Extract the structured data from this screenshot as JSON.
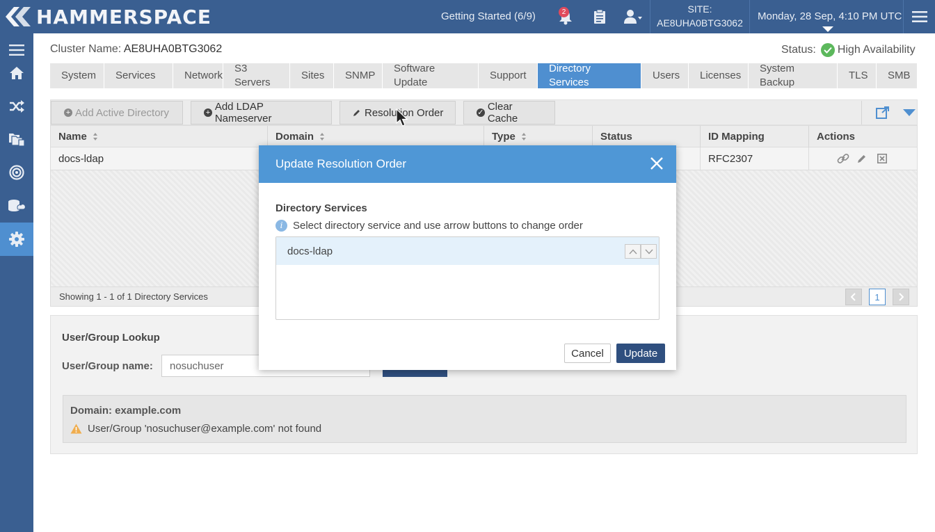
{
  "header": {
    "brand": "HAMMERSPACE",
    "getting_started": "Getting Started (6/9)",
    "notification_count": "2",
    "site_label": "SITE:",
    "site_name": "AE8UHA0BTG3062",
    "datetime": "Monday, 28 Sep, 4:10 PM UTC",
    "icons": [
      "bell-icon",
      "clipboard-icon",
      "user-icon",
      "hamburger-icon"
    ]
  },
  "sidebar": {
    "items": [
      {
        "name": "menu",
        "icon": "hamburger-icon"
      },
      {
        "name": "home",
        "icon": "home-icon"
      },
      {
        "name": "shuffle",
        "icon": "shuffle-icon"
      },
      {
        "name": "shares",
        "icon": "folders-icon"
      },
      {
        "name": "objectives",
        "icon": "target-icon"
      },
      {
        "name": "storage",
        "icon": "storage-icon"
      },
      {
        "name": "settings",
        "icon": "gear-icon",
        "active": true
      }
    ]
  },
  "main": {
    "cluster_label": "Cluster Name:",
    "cluster_name": "AE8UHA0BTG3062",
    "status_label": "Status:",
    "status_value": "High Availability",
    "tabs": [
      {
        "label": "System"
      },
      {
        "label": "Services"
      },
      {
        "label": "Network"
      },
      {
        "label": "S3 Servers"
      },
      {
        "label": "Sites"
      },
      {
        "label": "SNMP"
      },
      {
        "label": "Software Update"
      },
      {
        "label": "Support"
      },
      {
        "label": "Directory Services",
        "active": true
      },
      {
        "label": "Users"
      },
      {
        "label": "Licenses"
      },
      {
        "label": "System Backup"
      },
      {
        "label": "TLS"
      },
      {
        "label": "SMB"
      }
    ],
    "toolbar": {
      "add_ad": "Add Active Directory",
      "add_ldap": "Add LDAP Nameserver",
      "resolution_order": "Resolution Order",
      "clear_cache": "Clear Cache"
    },
    "table": {
      "columns": [
        "Name",
        "Domain",
        "Type",
        "Status",
        "ID Mapping",
        "Actions"
      ],
      "rows": [
        {
          "name": "docs-ldap",
          "domain": "",
          "type": "",
          "status": "",
          "id_mapping": "RFC2307"
        }
      ],
      "footer": "Showing 1 - 1 of 1 Directory Services",
      "page": "1"
    },
    "lookup": {
      "title": "User/Group Lookup",
      "label": "User/Group name:",
      "value": "nosuchuser",
      "result_domain": "Domain: example.com",
      "result_message": "User/Group 'nosuchuser@example.com' not found"
    }
  },
  "modal": {
    "title": "Update Resolution Order",
    "section_title": "Directory Services",
    "hint": "Select directory service and use arrow buttons to change order",
    "items": [
      "docs-ldap"
    ],
    "cancel": "Cancel",
    "update": "Update"
  },
  "colors": {
    "topbar": "#3a5f91",
    "accent": "#4f8fd0",
    "modal_header": "#4f97d6",
    "primary_button": "#2f4f7f",
    "success": "#5cb85c"
  }
}
